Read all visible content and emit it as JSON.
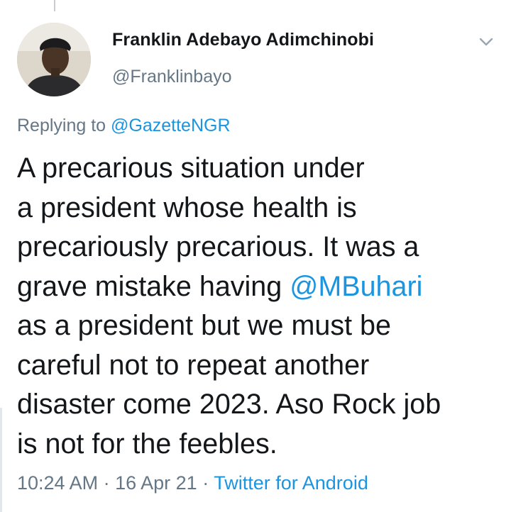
{
  "tweet": {
    "author": {
      "name": "Franklin Adebayo Adimchinobi",
      "handle": "@Franklinbayo"
    },
    "reply": {
      "prefix": "Replying to",
      "to": "@GazetteNGR"
    },
    "text": {
      "line1": "A precarious situation under",
      "line2": "a president whose health is",
      "line3": "precariously precarious. It was a",
      "line4_prefix": "grave mistake having",
      "mention": "@MBuhari",
      "line5": "as a president but we must be",
      "line6": "careful not to repeat another",
      "line7": "disaster come 2023. Aso Rock job",
      "line8": "is not for the feebles."
    },
    "meta": {
      "time": "10:24 AM",
      "separator": "·",
      "date": "16 Apr 21",
      "source": "Twitter for Android"
    },
    "icons": {
      "menu": "chevron-down-icon",
      "avatar": "profile-photo"
    },
    "colors": {
      "link": "#1b95e0",
      "secondary": "#657786",
      "text": "#14171a"
    }
  }
}
